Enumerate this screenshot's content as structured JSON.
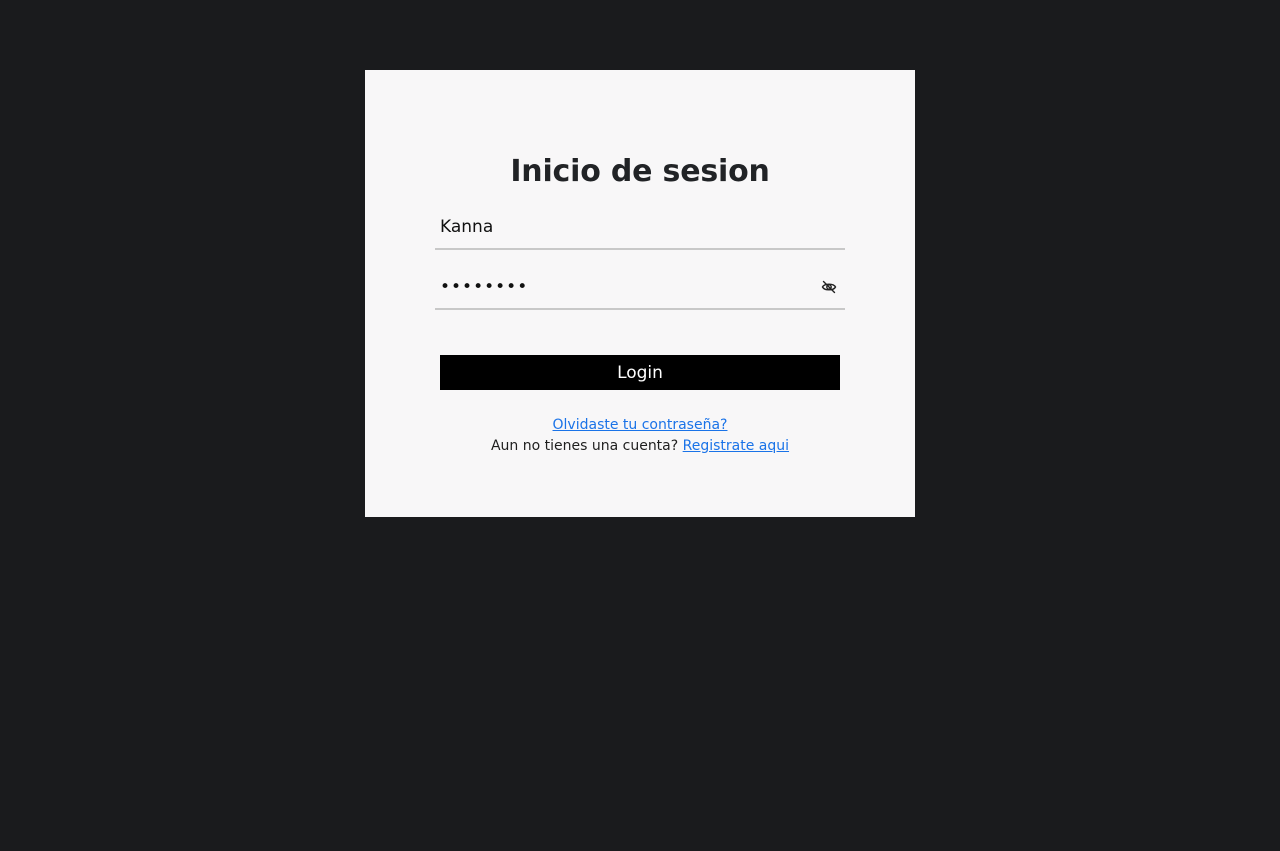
{
  "login_form": {
    "title": "Inicio de sesion",
    "username_value": "Kanna",
    "password_value": "••••••••",
    "login_button_label": "Login",
    "forgot_password_link": "Olvidaste tu contraseña?",
    "no_account_text": "Aun no tienes una cuenta?",
    "register_link": "Registrate aqui",
    "toggle_visibility_icon": "eye-off-icon"
  },
  "colors": {
    "page_background": "#1a1b1d",
    "card_background": "#f8f7f8",
    "button_background": "#000000",
    "link_color": "#1a73e8"
  }
}
